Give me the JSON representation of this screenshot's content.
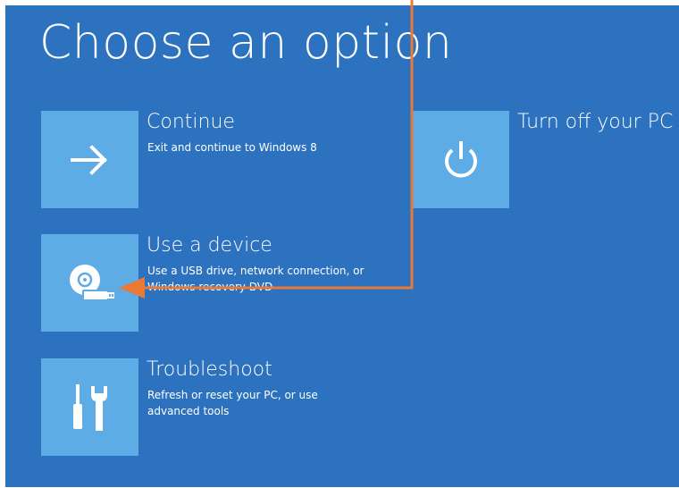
{
  "screen": {
    "title": "Choose an option"
  },
  "options": [
    {
      "label": "Continue",
      "description": "Exit and continue to Windows 8",
      "icon": "arrow-right-icon"
    },
    {
      "label": "Use a device",
      "description": "Use a USB drive, network connection, or Windows recovery DVD",
      "icon": "device-disc-usb-icon"
    },
    {
      "label": "Troubleshoot",
      "description": "Refresh or reset your PC, or use advanced tools",
      "icon": "tools-icon"
    },
    {
      "label": "Turn off your PC",
      "description": "",
      "icon": "power-icon"
    }
  ],
  "colors": {
    "background": "#2d72be",
    "tile": "#5eace5",
    "text": "#ffffff",
    "annotation": "#e87a35"
  }
}
